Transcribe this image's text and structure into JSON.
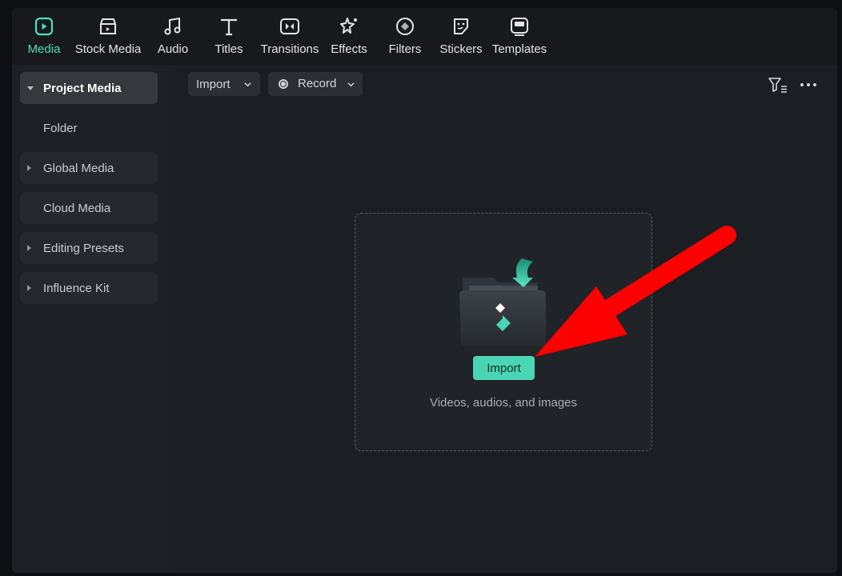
{
  "toolbar": {
    "items": [
      {
        "label": "Media",
        "icon": "media-icon",
        "active": true
      },
      {
        "label": "Stock Media",
        "icon": "stock-media-icon"
      },
      {
        "label": "Audio",
        "icon": "music-note-icon"
      },
      {
        "label": "Titles",
        "icon": "text-t-icon"
      },
      {
        "label": "Transitions",
        "icon": "transitions-icon"
      },
      {
        "label": "Effects",
        "icon": "sparkle-effects-icon"
      },
      {
        "label": "Filters",
        "icon": "filters-icon"
      },
      {
        "label": "Stickers",
        "icon": "sticker-icon"
      },
      {
        "label": "Templates",
        "icon": "templates-icon"
      }
    ]
  },
  "sidebar": {
    "items": [
      {
        "label": "Project Media"
      },
      {
        "label": "Folder"
      },
      {
        "label": "Global Media"
      },
      {
        "label": "Cloud Media"
      },
      {
        "label": "Editing Presets"
      },
      {
        "label": "Influence Kit"
      }
    ]
  },
  "main": {
    "import_dropdown": "Import",
    "record_dropdown": "Record",
    "dropzone": {
      "button": "Import",
      "hint": "Videos, audios, and images"
    }
  },
  "colors": {
    "accent": "#4fdfc0",
    "annotation_arrow": "#ff0000"
  }
}
